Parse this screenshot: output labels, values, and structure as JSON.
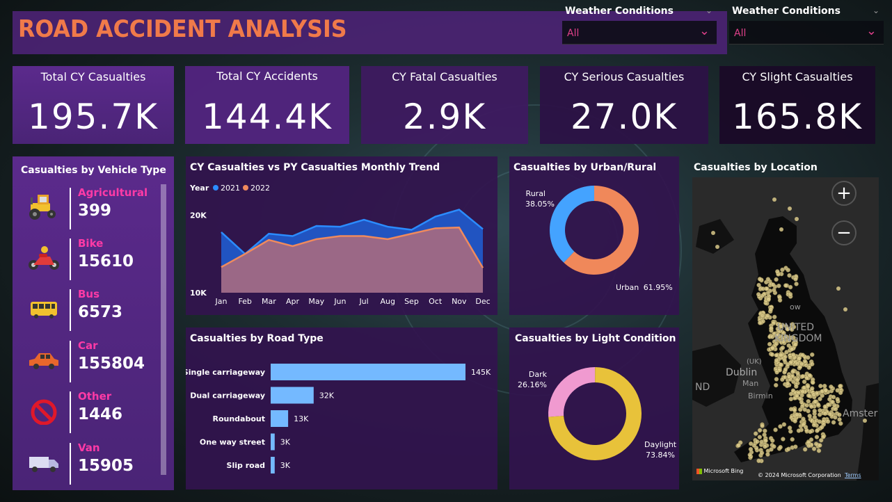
{
  "title": "ROAD ACCIDENT ANALYSIS",
  "slicers": [
    {
      "title": "Weather Conditions",
      "value": "All"
    },
    {
      "title": "Weather Conditions",
      "value": "All"
    }
  ],
  "kpis": [
    {
      "title": "Total CY Casualties",
      "value": "195.7K"
    },
    {
      "title": "Total CY Accidents",
      "value": "144.4K"
    },
    {
      "title": "CY Fatal Casualties",
      "value": "2.9K"
    },
    {
      "title": "CY Serious Casualties",
      "value": "27.0K"
    },
    {
      "title": "CY Slight Casualties",
      "value": "165.8K"
    }
  ],
  "vehicle": {
    "title": "Casualties by Vehicle Type",
    "items": [
      {
        "name": "Agricultural",
        "value": "399",
        "icon": "tractor-icon"
      },
      {
        "name": "Bike",
        "value": "15610",
        "icon": "motorbike-icon"
      },
      {
        "name": "Bus",
        "value": "6573",
        "icon": "bus-icon"
      },
      {
        "name": "Car",
        "value": "155804",
        "icon": "car-icon"
      },
      {
        "name": "Other",
        "value": "1446",
        "icon": "prohibited-icon"
      },
      {
        "name": "Van",
        "value": "15905",
        "icon": "van-icon"
      }
    ]
  },
  "trend": {
    "title": "CY Casualties vs PY Casualties Monthly Trend",
    "legend_title": "Year",
    "legend": [
      {
        "name": "2021",
        "color": "#2b8cff"
      },
      {
        "name": "2022",
        "color": "#f08a5d"
      }
    ]
  },
  "road": {
    "title": "Casualties by Road Type"
  },
  "urban": {
    "title": "Casualties by Urban/Rural",
    "labels": [
      {
        "name": "Rural",
        "pct": "38.05%"
      },
      {
        "name": "Urban",
        "pct": "61.95%"
      }
    ]
  },
  "light": {
    "title": "Casualties by Light Condition",
    "labels": [
      {
        "name": "Dark",
        "pct": "26.16%"
      },
      {
        "name": "Daylight",
        "pct": "73.84%"
      }
    ]
  },
  "map": {
    "title": "Casualties by Location",
    "zoom_in": "+",
    "zoom_out": "−",
    "labels": {
      "country1": "UNITED",
      "country2": "KINGDOM",
      "dublin": "Dublin",
      "ams": "Amster",
      "nd": "ND",
      "birm": "Birmin",
      "man": "Man",
      "uk": "(UK)",
      "row": "ow"
    },
    "brand": "Microsoft Bing",
    "copyright": "© 2024 Microsoft Corporation",
    "terms": "Terms"
  },
  "chart_data": [
    {
      "type": "area",
      "title": "CY Casualties vs PY Casualties Monthly Trend",
      "x": [
        "Jan",
        "Feb",
        "Mar",
        "Apr",
        "May",
        "Jun",
        "Jul",
        "Aug",
        "Sep",
        "Oct",
        "Nov",
        "Dec"
      ],
      "yticks": [
        "20K",
        "10K"
      ],
      "ylim": [
        10000,
        22000
      ],
      "series": [
        {
          "name": "2021",
          "values": [
            17800,
            15000,
            17600,
            17300,
            18600,
            18500,
            19400,
            18500,
            18100,
            19800,
            20700,
            18200
          ]
        },
        {
          "name": "2022",
          "values": [
            13300,
            15000,
            16800,
            16000,
            16900,
            17300,
            17300,
            16900,
            17600,
            18300,
            18400,
            13200
          ]
        }
      ]
    },
    {
      "type": "bar",
      "title": "Casualties by Road Type",
      "categories": [
        "Single carriageway",
        "Dual carriageway",
        "Roundabout",
        "One way street",
        "Slip road"
      ],
      "values": [
        145000,
        32000,
        13000,
        3000,
        3000
      ],
      "data_labels": [
        "145K",
        "32K",
        "13K",
        "3K",
        "3K"
      ],
      "color": "#74b9ff"
    },
    {
      "type": "pie",
      "title": "Casualties by Urban/Rural",
      "categories": [
        "Rural",
        "Urban"
      ],
      "values": [
        38.05,
        61.95
      ],
      "colors": [
        "#44a3ff",
        "#f0885a"
      ]
    },
    {
      "type": "pie",
      "title": "Casualties by Light Condition",
      "categories": [
        "Dark",
        "Daylight"
      ],
      "values": [
        26.16,
        73.84
      ],
      "colors": [
        "#f09ad0",
        "#e8c23a"
      ]
    }
  ]
}
